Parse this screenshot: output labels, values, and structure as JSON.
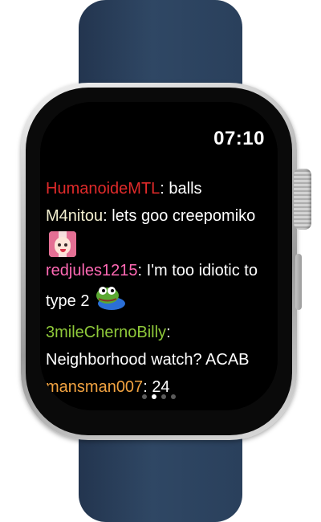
{
  "status_bar": {
    "time": "07:10"
  },
  "chat": {
    "messages": [
      {
        "user": "HumanoideMTL",
        "user_color": "#e02a2a",
        "text": "balls"
      },
      {
        "user": "M4nitou",
        "user_color": "#f3efd0",
        "text": "lets goo creepomiko",
        "emote": "creepomiko-anime-girl-emote-icon"
      },
      {
        "user": "redjules1215",
        "user_color": "#ff69b4",
        "text": "I'm too idiotic to type 2",
        "emote": "pepe-frog-emote-icon"
      },
      {
        "user": "3mileChernoBilly",
        "user_color": "#8fc93a",
        "text": "Neighborhood watch? ACAB"
      },
      {
        "user": "mansman007",
        "user_color": "#f2a341",
        "text": "24"
      }
    ]
  },
  "page_indicator": {
    "count": 4,
    "active_index": 1
  }
}
